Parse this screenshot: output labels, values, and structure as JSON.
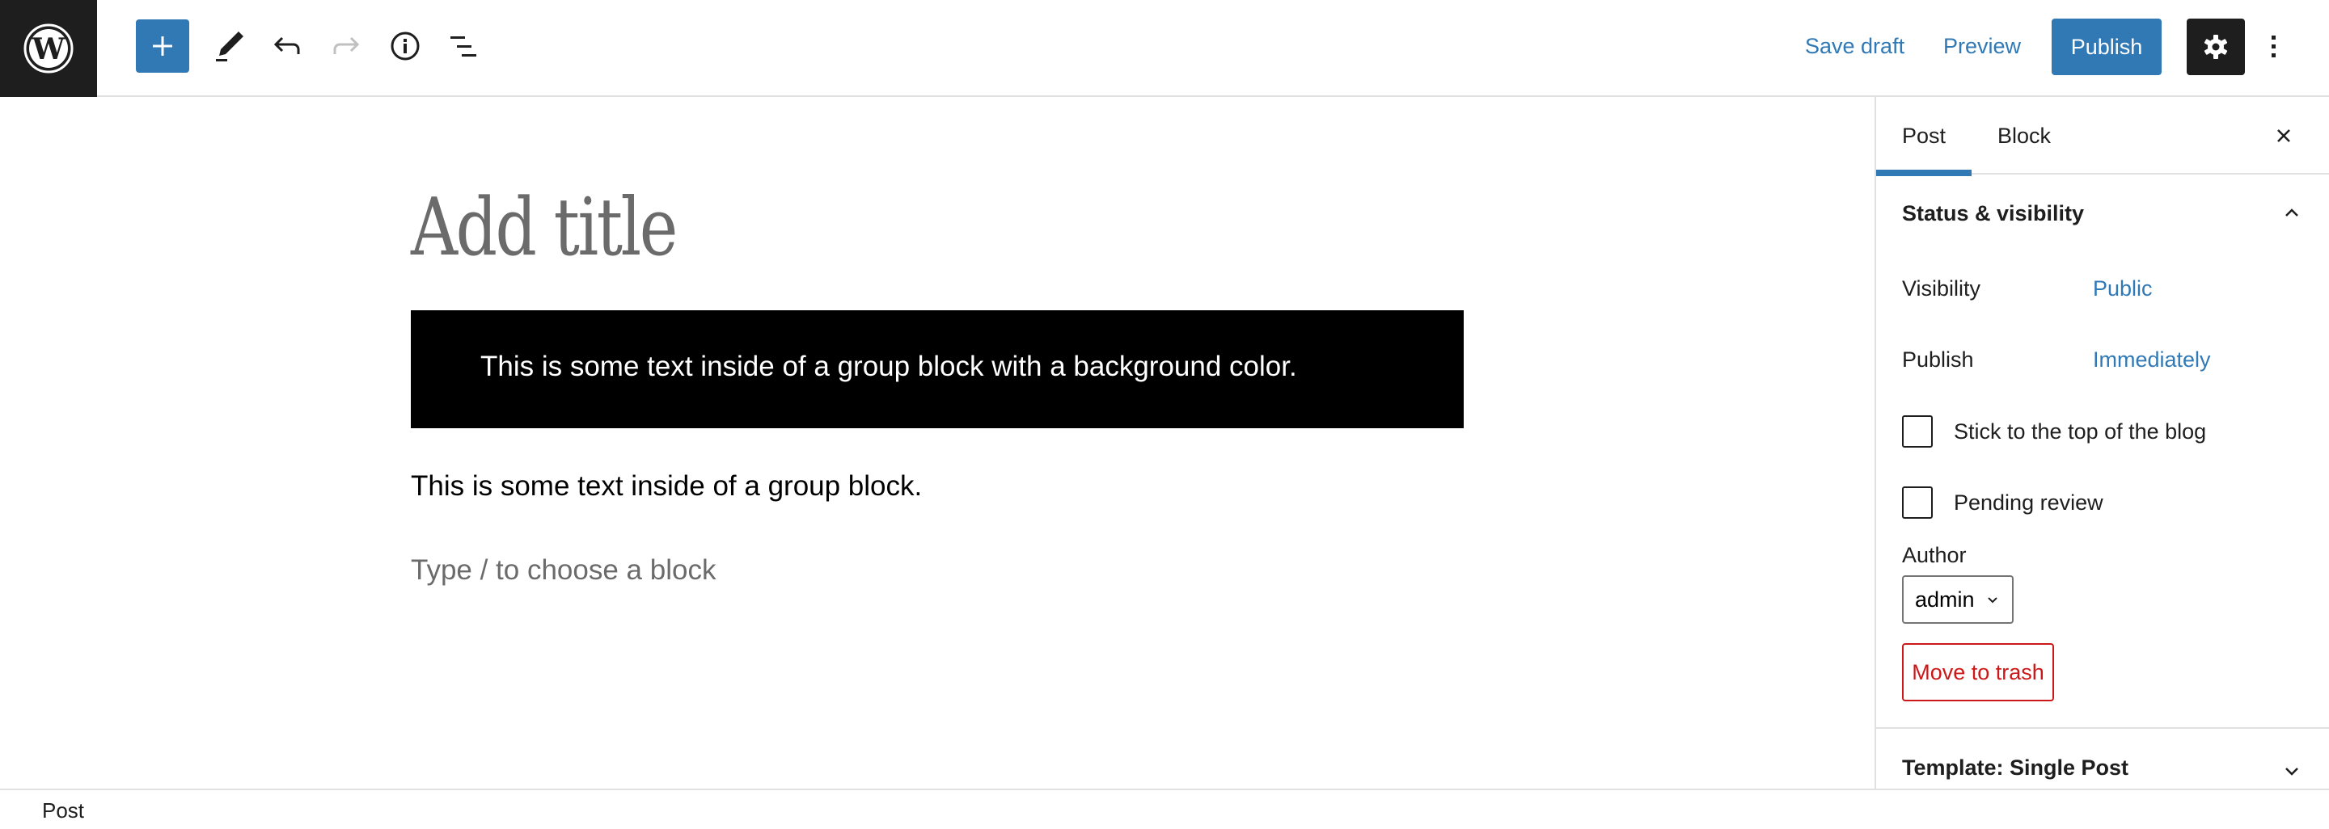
{
  "header": {
    "logo": "wordpress-logo",
    "toolbar": {
      "inserter_icon": "plus-icon",
      "tools_icon": "pencil-icon",
      "undo_icon": "undo-icon",
      "redo_icon": "redo-icon",
      "details_icon": "info-icon",
      "list_view_icon": "list-view-icon"
    },
    "save_draft_label": "Save draft",
    "preview_label": "Preview",
    "publish_label": "Publish",
    "settings_icon": "gear-icon",
    "more_icon": "more-vertical-icon"
  },
  "editor": {
    "title_placeholder": "Add title",
    "group_block_text": "This is some text inside of a group block with a background color.",
    "group_block_background": "#000000",
    "paragraph_text": "This is some text inside of a group block.",
    "appender_placeholder": "Type / to choose a block"
  },
  "sidebar": {
    "tabs": [
      {
        "label": "Post",
        "active": true
      },
      {
        "label": "Block",
        "active": false
      }
    ],
    "close_icon": "close-icon",
    "status_panel": {
      "title": "Status & visibility",
      "expanded": true,
      "visibility_label": "Visibility",
      "visibility_value": "Public",
      "publish_label": "Publish",
      "publish_value": "Immediately",
      "checkboxes": [
        {
          "label": "Stick to the top of the blog",
          "checked": false
        },
        {
          "label": "Pending review",
          "checked": false
        }
      ],
      "author_label": "Author",
      "author_value": "admin",
      "trash_label": "Move to trash"
    },
    "template_panel": {
      "title": "Template: Single Post",
      "expanded": false
    }
  },
  "footer": {
    "breadcrumb": "Post"
  },
  "colors": {
    "accent": "#3079b5",
    "dark": "#1e1e1e",
    "destructive": "#cc1818",
    "border": "#e0e0e0"
  }
}
